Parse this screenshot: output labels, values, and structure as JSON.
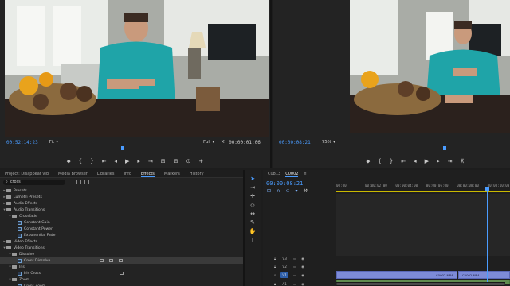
{
  "source_monitor": {
    "timecode": "00:52:14:23",
    "fit": "Fit",
    "quality": "Full",
    "duration": "00:00:01:06"
  },
  "program_monitor": {
    "timecode": "00:00:08:21",
    "zoom": "75%"
  },
  "effects_panel": {
    "tabs": [
      "Project: Disappear vid",
      "Media Browser",
      "Libraries",
      "Info",
      "Effects",
      "Markers",
      "History"
    ],
    "active_tab": "Effects",
    "search_value": "cross",
    "tree": [
      {
        "label": "Presets",
        "level": 0,
        "type": "folder",
        "expanded": false
      },
      {
        "label": "Lumetri Presets",
        "level": 0,
        "type": "folder",
        "expanded": false
      },
      {
        "label": "Audio Effects",
        "level": 0,
        "type": "folder",
        "expanded": false
      },
      {
        "label": "Audio Transitions",
        "level": 0,
        "type": "folder",
        "expanded": true
      },
      {
        "label": "Crossfade",
        "level": 1,
        "type": "folder",
        "expanded": true
      },
      {
        "label": "Constant Gain",
        "level": 2,
        "type": "effect"
      },
      {
        "label": "Constant Power",
        "level": 2,
        "type": "effect"
      },
      {
        "label": "Exponential Fade",
        "level": 2,
        "type": "effect"
      },
      {
        "label": "Video Effects",
        "level": 0,
        "type": "folder",
        "expanded": false
      },
      {
        "label": "Video Transitions",
        "level": 0,
        "type": "folder",
        "expanded": true
      },
      {
        "label": "Dissolve",
        "level": 1,
        "type": "folder",
        "expanded": true
      },
      {
        "label": "Cross Dissolve",
        "level": 2,
        "type": "effect",
        "selected": true
      },
      {
        "label": "Iris",
        "level": 1,
        "type": "folder",
        "expanded": true
      },
      {
        "label": "Iris Cross",
        "level": 2,
        "type": "effect"
      },
      {
        "label": "Zoom",
        "level": 1,
        "type": "folder",
        "expanded": true
      },
      {
        "label": "Cross Zoom",
        "level": 2,
        "type": "effect"
      }
    ]
  },
  "timeline": {
    "tabs": [
      "C0813",
      "C0002"
    ],
    "active_tab": "C0002",
    "timecode": "00:00:08:21",
    "ruler_labels": [
      "00:00",
      "00:00:02:00",
      "00:00:04:00",
      "00:00:06:00",
      "00:00:08:00",
      "00:00:10:00"
    ],
    "tracks": [
      {
        "name": "V3",
        "targeted": false
      },
      {
        "name": "V2",
        "targeted": false
      },
      {
        "name": "V1",
        "targeted": true
      },
      {
        "name": "A1",
        "targeted": false
      }
    ],
    "clips": [
      "C0002.MP4",
      "C0002.MP4"
    ]
  },
  "colors": {
    "accent": "#4a9cff",
    "work_area": "#c9b800",
    "clip": "#7d8bd8"
  }
}
